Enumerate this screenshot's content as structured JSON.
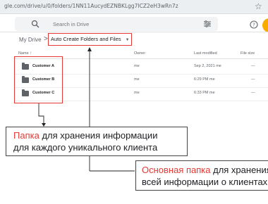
{
  "browser": {
    "url": "gle.com/drive/u/0/folders/1NN11AucydEZNBKLgg7ICZ2eH3wRn7z"
  },
  "header": {
    "search_placeholder": "Search in Drive"
  },
  "breadcrumb": {
    "root": "My Drive",
    "separator": ">",
    "current": "Auto Create Folders and Files",
    "caret": "▼"
  },
  "columns": {
    "name": "Name",
    "sort_arrow": "↑",
    "owner": "Owner",
    "last_modified": "Last modified",
    "file_size": "File size"
  },
  "rows": [
    {
      "name": "Customer A",
      "owner": "me",
      "modified": "Sep 2, 2021 me",
      "size": "—"
    },
    {
      "name": "Customer B",
      "owner": "me",
      "modified": "6:29 PM me",
      "size": "—"
    },
    {
      "name": "Customer C",
      "owner": "me",
      "modified": "6:33 PM me",
      "size": "—"
    }
  ],
  "callouts": {
    "folder_note": {
      "highlight": "Папка",
      "line1_rest": " для хранения информации",
      "line2": "для каждого уникального клиента"
    },
    "main_note": {
      "highlight": "Основная папка",
      "line1_rest": " для хранения",
      "line2": "всей информации о клиентах"
    }
  },
  "colors": {
    "highlight_red": "#e53935",
    "avatar": "#f9ab00"
  }
}
